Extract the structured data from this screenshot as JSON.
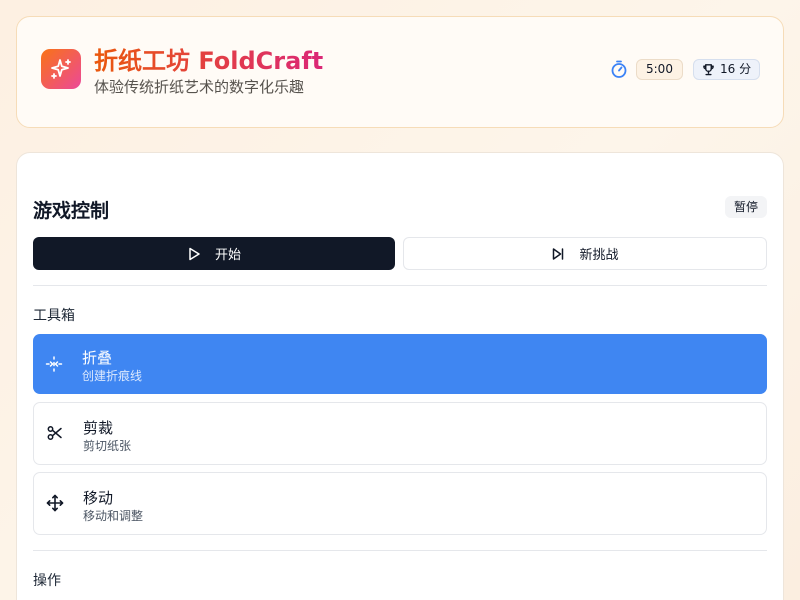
{
  "header": {
    "title": "折纸工坊 FoldCraft",
    "subtitle": "体验传统折纸艺术的数字化乐趣",
    "timer": "5:00",
    "score": "16 分",
    "logo_icon": "sparkles-icon",
    "timer_icon": "stopwatch-icon",
    "score_icon": "trophy-icon",
    "accent_gradient": [
      "#f97316",
      "#ec4899"
    ]
  },
  "controls": {
    "title": "游戏控制",
    "status": "暂停",
    "start_label": "开始",
    "start_icon": "play-icon",
    "new_label": "新挑战",
    "new_icon": "skip-forward-icon"
  },
  "toolbox": {
    "title": "工具箱",
    "tools": [
      {
        "label": "折叠",
        "description": "创建折痕线",
        "icon": "fold-icon",
        "active": true
      },
      {
        "label": "剪裁",
        "description": "剪切纸张",
        "icon": "scissors-icon",
        "active": false
      },
      {
        "label": "移动",
        "description": "移动和调整",
        "icon": "move-icon",
        "active": false
      }
    ],
    "active_color": "#3f86f2"
  },
  "actions": {
    "title": "操作"
  }
}
